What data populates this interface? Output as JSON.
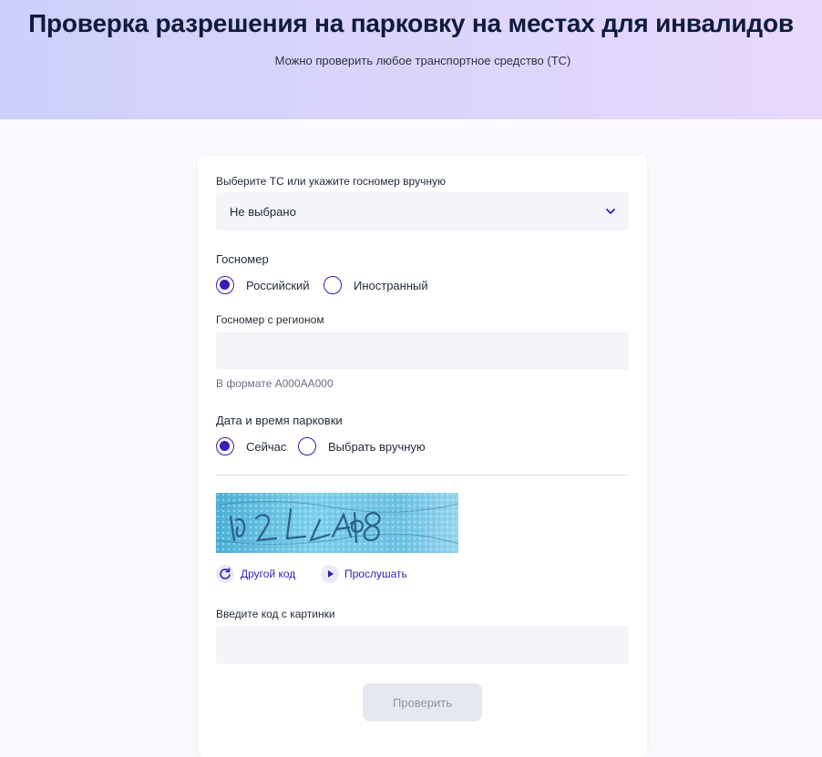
{
  "header": {
    "title": "Проверка разрешения на парковку на местах для инвалидов",
    "subtitle": "Можно проверить любое транспортное средство (ТС)"
  },
  "form": {
    "vehicle_select": {
      "label": "Выберите ТС или укажите госномер вручную",
      "value": "Не выбрано"
    },
    "plate_type": {
      "title": "Госномер",
      "options": [
        "Российский",
        "Иностранный"
      ],
      "selected": "Российский"
    },
    "plate_input": {
      "label": "Госномер с регионом",
      "value": "",
      "hint": "В формате А000АА000"
    },
    "parking_time": {
      "title": "Дата и время парковки",
      "options": [
        "Сейчас",
        "Выбрать вручную"
      ],
      "selected": "Сейчас"
    },
    "captcha": {
      "image_icon": "captcha-image",
      "refresh_label": "Другой код",
      "refresh_icon": "refresh-icon",
      "listen_label": "Прослушать",
      "listen_icon": "play-icon"
    },
    "code_input": {
      "label": "Введите код с картинки",
      "value": ""
    },
    "submit_label": "Проверить"
  },
  "colors": {
    "accent": "#3a1cb7",
    "hero_gradient_start": "#cdd0fb",
    "hero_gradient_end": "#e8d8fc",
    "field_bg": "#f3f5f9",
    "button_disabled_bg": "#e5e8ef",
    "button_disabled_text": "#8e97a6"
  }
}
